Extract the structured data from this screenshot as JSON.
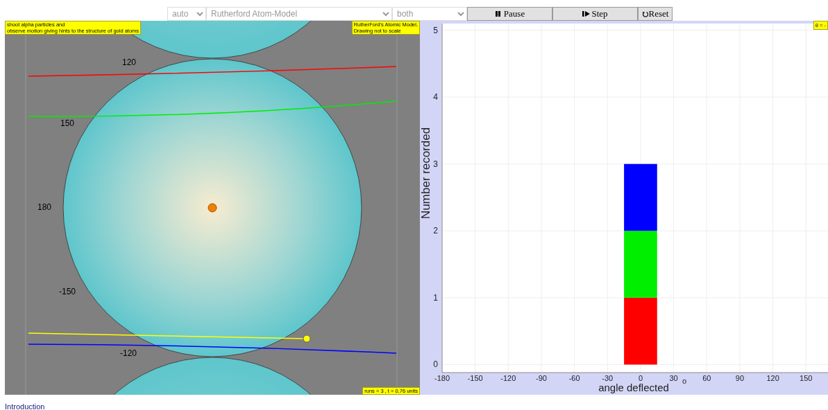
{
  "controls": {
    "selects": [
      {
        "value": "auto",
        "disabled": true
      },
      {
        "value": "Rutherford Atom-Model",
        "disabled": true
      },
      {
        "value": "both",
        "disabled": true
      }
    ],
    "buttons": [
      {
        "kind": "pause",
        "label": "Pause"
      },
      {
        "kind": "step",
        "label": "Step"
      },
      {
        "kind": "reset",
        "label": "Reset"
      }
    ]
  },
  "simulation": {
    "notes": [
      {
        "kind": "top-left",
        "lines": [
          "shoot alpha particles and",
          "observe motion giving hints to the structure of gold atoms"
        ]
      },
      {
        "kind": "top-right",
        "lines": [
          "RutherFord's Atomic Model,",
          "Drawing not to scale"
        ]
      },
      {
        "kind": "bottom-right",
        "lines": [
          "runs = 3 , t = 0,76 units"
        ]
      }
    ],
    "angle_labels": [
      "120",
      "150",
      "180",
      "-150",
      "-120"
    ]
  },
  "chart": {
    "corner_label": "θ = -",
    "unit_label": "o",
    "chart_data": {
      "type": "bar",
      "xlabel": "angle deflected",
      "ylabel": "Number recorded",
      "x": [
        0
      ],
      "stacked": true,
      "grid": true,
      "xlim": [
        -180,
        170
      ],
      "ylim": [
        -0.12,
        5.1
      ],
      "xticks": [
        -180,
        -150,
        -120,
        -90,
        -60,
        -30,
        0,
        30,
        60,
        90,
        120,
        150
      ],
      "yticks": [
        0,
        1,
        2,
        3,
        4,
        5
      ],
      "series": [
        {
          "color": "#ff0000",
          "values": [
            1
          ]
        },
        {
          "color": "#00ee00",
          "values": [
            1
          ]
        },
        {
          "color": "#0000ff",
          "values": [
            1
          ]
        }
      ]
    }
  },
  "footer_link": "Introduction"
}
